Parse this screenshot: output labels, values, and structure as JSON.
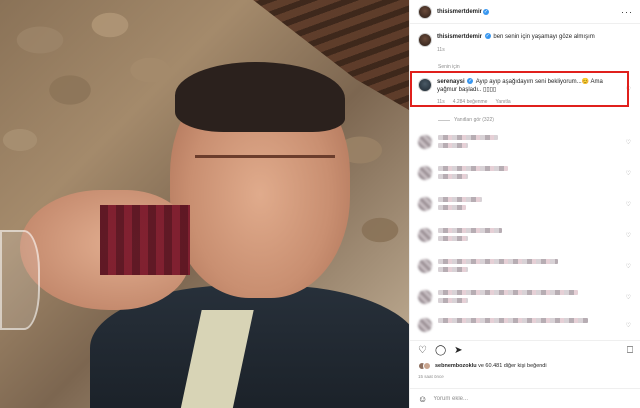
{
  "post": {
    "username": "thisismertdemir",
    "caption": "ben senin için yaşamayı göze almışım",
    "caption_time": "11s",
    "translate_label": "Senin için",
    "view_replies": "Yanıtları gör (322)",
    "likes_text_user": "sebnembozoklu",
    "likes_text_rest": "ve 60.481 diğer kişi beğendi",
    "date": "15 saat önce",
    "comment_placeholder": "Yorum ekle..."
  },
  "highlighted_comment": {
    "username": "serenaysi",
    "text": "Ayıp ayıp aşağıdayım seni bekliyorum...😊 Ama yağmur başladı.. ▯▯▯▯",
    "time": "11s",
    "likes": "4.284 beğenme",
    "reply": "Yanıtla"
  },
  "icons": {
    "more": "more-icon",
    "like": "heart-icon",
    "comment": "comment-icon",
    "share": "share-icon",
    "save": "bookmark-icon",
    "emoji": "emoji-icon"
  },
  "colors": {
    "highlight_border": "#e0201c",
    "verified": "#3897f0",
    "muted": "#8e8e8e"
  }
}
